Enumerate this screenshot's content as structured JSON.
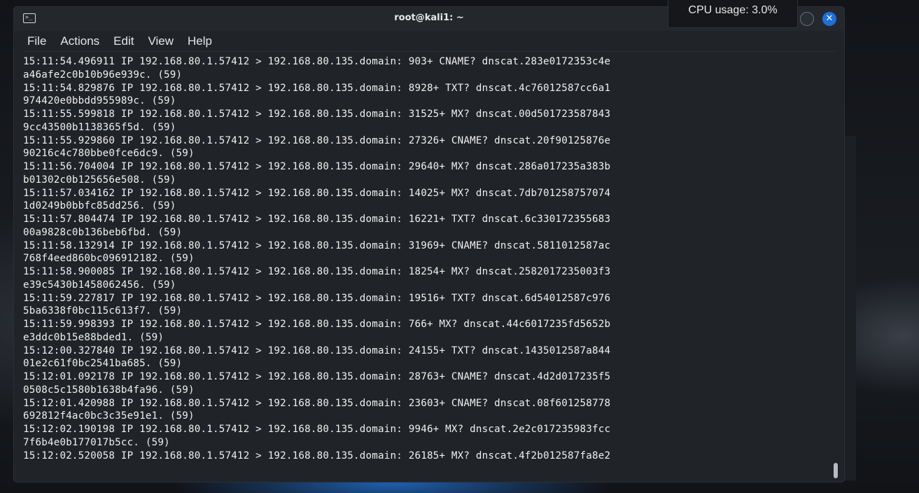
{
  "window": {
    "title": "root@kali1: ~",
    "icon": "terminal-icon"
  },
  "menu": [
    "File",
    "Actions",
    "Edit",
    "View",
    "Help"
  ],
  "tooltip": {
    "cpu": "CPU usage: 3.0%"
  },
  "colors": {
    "close_button": "#1e6fd9",
    "terminal_bg": "#202327",
    "text": "#f0f0f0"
  },
  "terminal": {
    "lines": [
      "15:11:54.496911 IP 192.168.80.1.57412 > 192.168.80.135.domain: 903+ CNAME? dnscat.283e0172353c4e",
      "a46afe2c0b10b96e939c. (59)",
      "15:11:54.829876 IP 192.168.80.1.57412 > 192.168.80.135.domain: 8928+ TXT? dnscat.4c76012587cc6a1",
      "974420e0bbdd955989c. (59)",
      "15:11:55.599818 IP 192.168.80.1.57412 > 192.168.80.135.domain: 31525+ MX? dnscat.00d501723587843",
      "9cc43500b1138365f5d. (59)",
      "15:11:55.929860 IP 192.168.80.1.57412 > 192.168.80.135.domain: 27326+ CNAME? dnscat.20f90125876e",
      "90216c4c780bbe0fce6dc9. (59)",
      "15:11:56.704004 IP 192.168.80.1.57412 > 192.168.80.135.domain: 29640+ MX? dnscat.286a017235a383b",
      "b01302c0b125656e508. (59)",
      "15:11:57.034162 IP 192.168.80.1.57412 > 192.168.80.135.domain: 14025+ MX? dnscat.7db701258757074",
      "1d0249b0bbfc85dd256. (59)",
      "15:11:57.804474 IP 192.168.80.1.57412 > 192.168.80.135.domain: 16221+ TXT? dnscat.6c330172355683",
      "00a9828c0b136beb6fbd. (59)",
      "15:11:58.132914 IP 192.168.80.1.57412 > 192.168.80.135.domain: 31969+ CNAME? dnscat.5811012587ac",
      "768f4eed860bc096912182. (59)",
      "15:11:58.900085 IP 192.168.80.1.57412 > 192.168.80.135.domain: 18254+ MX? dnscat.2582017235003f3",
      "e39c5430b1458062456. (59)",
      "15:11:59.227817 IP 192.168.80.1.57412 > 192.168.80.135.domain: 19516+ TXT? dnscat.6d54012587c976",
      "5ba6338f0bc115c613f7. (59)",
      "15:11:59.998393 IP 192.168.80.1.57412 > 192.168.80.135.domain: 766+ MX? dnscat.44c6017235fd5652b",
      "e3ddc0b15e88bded1. (59)",
      "15:12:00.327840 IP 192.168.80.1.57412 > 192.168.80.135.domain: 24155+ TXT? dnscat.1435012587a844",
      "01e2c61f0bc2541ba685. (59)",
      "15:12:01.092178 IP 192.168.80.1.57412 > 192.168.80.135.domain: 28763+ CNAME? dnscat.4d2d017235f5",
      "0508c5c1580b1638b4fa96. (59)",
      "15:12:01.420988 IP 192.168.80.1.57412 > 192.168.80.135.domain: 23603+ CNAME? dnscat.08f601258778",
      "692812f4ac0bc3c35e91e1. (59)",
      "15:12:02.190198 IP 192.168.80.1.57412 > 192.168.80.135.domain: 9946+ MX? dnscat.2e2c017235983fcc",
      "7f6b4e0b177017b5cc. (59)",
      "15:12:02.520058 IP 192.168.80.1.57412 > 192.168.80.135.domain: 26185+ MX? dnscat.4f2b012587fa8e2"
    ]
  }
}
